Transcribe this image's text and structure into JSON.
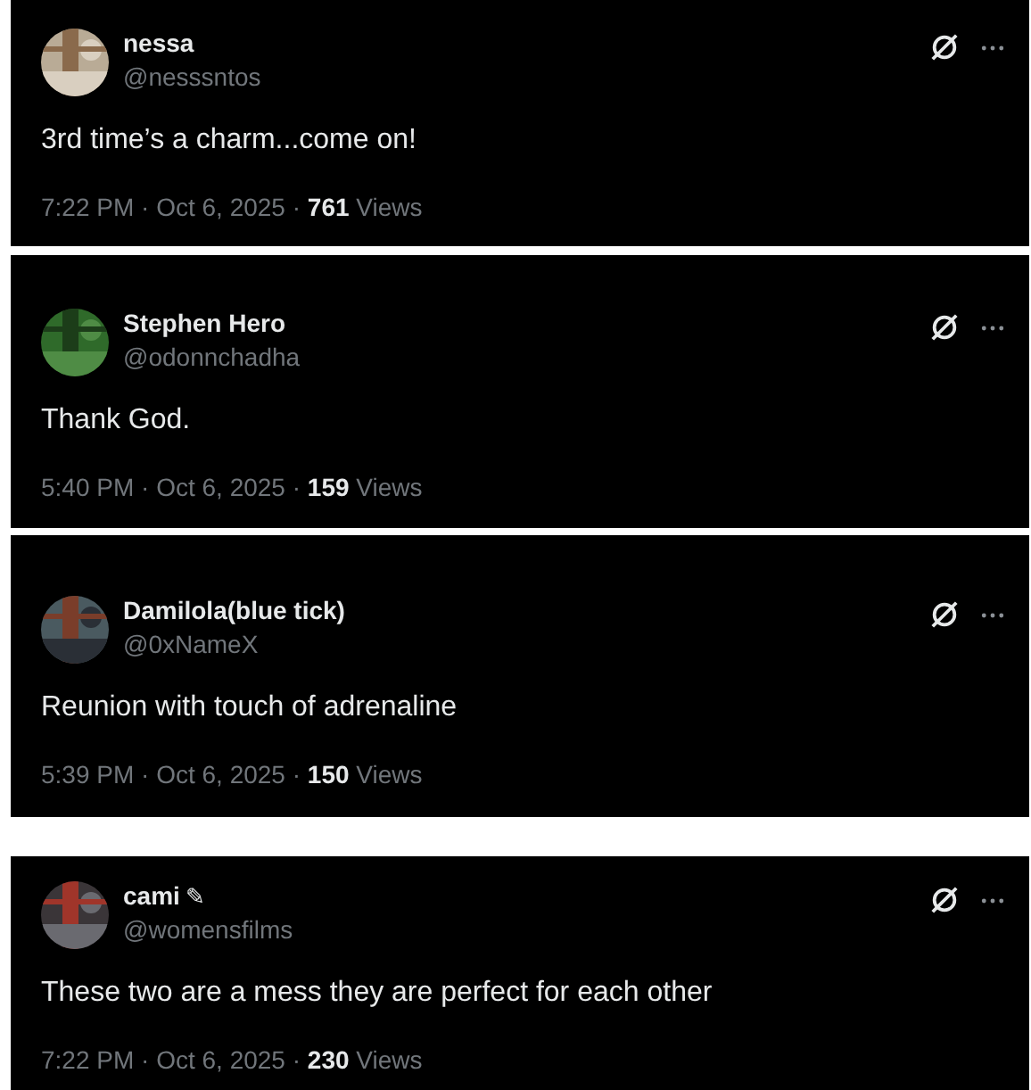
{
  "posts": [
    {
      "name": "nessa",
      "handle": "@nesssntos",
      "text": "3rd time’s a charm...come on!",
      "time": "7:22 PM · Oct 6, 2025 · ",
      "views_count": "761",
      "views_label": "Views"
    },
    {
      "name": "Stephen Hero",
      "handle": "@odonnchadha",
      "text": "Thank God.",
      "time": "5:40 PM · Oct 6, 2025 · ",
      "views_count": "159",
      "views_label": "Views"
    },
    {
      "name": "Damilola(blue tick)",
      "handle": "@0xNameX",
      "text": "Reunion with touch of adrenaline",
      "time": "5:39 PM · Oct 6, 2025 · ",
      "views_count": "150",
      "views_label": "Views"
    },
    {
      "name": "cami",
      "badge": "✎",
      "handle": "@womensfilms",
      "text": "These two are a mess they are perfect for each other",
      "time": "7:22 PM · Oct 6, 2025 · ",
      "views_count": "230",
      "views_label": "Views"
    }
  ]
}
